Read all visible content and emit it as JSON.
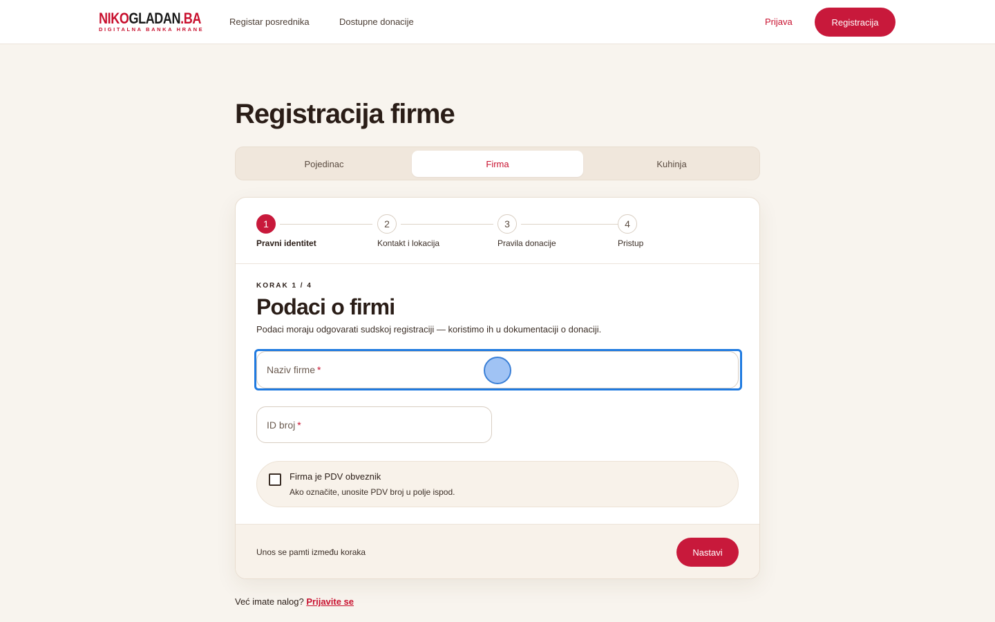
{
  "header": {
    "logo_red": "NIKO",
    "logo_dark": "GLADAN",
    "logo_suffix": ".BA",
    "logo_tagline": "DIGITALNA BANKA HRANE",
    "nav": [
      "Registar posrednika",
      "Dostupne donacije"
    ],
    "login_label": "Prijava",
    "register_label": "Registracija"
  },
  "page": {
    "title": "Registracija firme"
  },
  "tabs": {
    "items": [
      "Pojedinac",
      "Firma",
      "Kuhinja"
    ],
    "active": "Firma"
  },
  "stepper": {
    "current": 1,
    "steps": [
      {
        "number": "1",
        "label": "Pravni identitet"
      },
      {
        "number": "2",
        "label": "Kontakt i lokacija"
      },
      {
        "number": "3",
        "label": "Pravila donacije"
      },
      {
        "number": "4",
        "label": "Pristup"
      }
    ]
  },
  "form": {
    "step_count": "KORAK 1 / 4",
    "section_title": "Podaci o firmi",
    "section_desc": "Podaci moraju odgovarati sudskoj registraciji — koristimo ih u dokumentaciji o donaciji.",
    "company_name_label": "Naziv firme",
    "id_number_label": "ID broj",
    "required_mark": "*",
    "pdv_title": "Firma je PDV obveznik",
    "pdv_desc": "Ako označite, unosite PDV broj u polje ispod.",
    "pdv_checked": false,
    "footer_note": "Unos se pamti između koraka",
    "next_label": "Nastavi"
  },
  "footer": {
    "prompt": "Već imate nalog?",
    "link": "Prijavite se"
  },
  "colors": {
    "accent": "#c8193b",
    "background": "#f8f4ee",
    "focus_ring": "#1f7ae0"
  }
}
